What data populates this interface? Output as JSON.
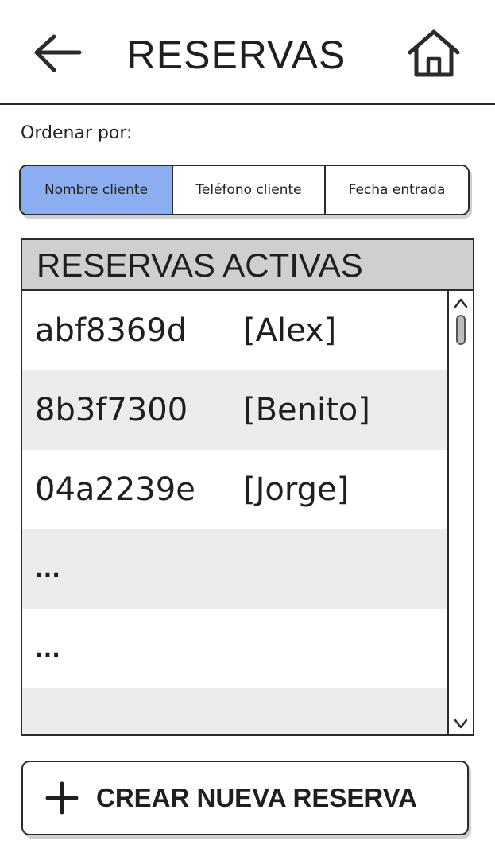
{
  "header": {
    "title": "RESERVAS",
    "back_icon": "arrow-left-icon",
    "home_icon": "home-icon"
  },
  "sort": {
    "label": "Ordenar por:",
    "options": [
      "Nombre cliente",
      "Teléfono cliente",
      "Fecha entrada"
    ],
    "selected": "Nombre cliente",
    "active_color": "#8aaef0"
  },
  "list": {
    "title": "RESERVAS ACTIVAS",
    "rows": [
      {
        "code": "abf8369d",
        "name": "[Alex]"
      },
      {
        "code": "8b3f7300",
        "name": "[Benito]"
      },
      {
        "code": "04a2239e",
        "name": "[Jorge]"
      },
      {
        "code": "...",
        "name": ""
      },
      {
        "code": "...",
        "name": ""
      },
      {
        "code": "",
        "name": ""
      }
    ],
    "scroll_up_icon": "chevron-up-icon",
    "scroll_down_icon": "chevron-down-icon"
  },
  "actions": {
    "create_label": "CREAR NUEVA RESERVA",
    "create_icon": "plus-icon"
  }
}
